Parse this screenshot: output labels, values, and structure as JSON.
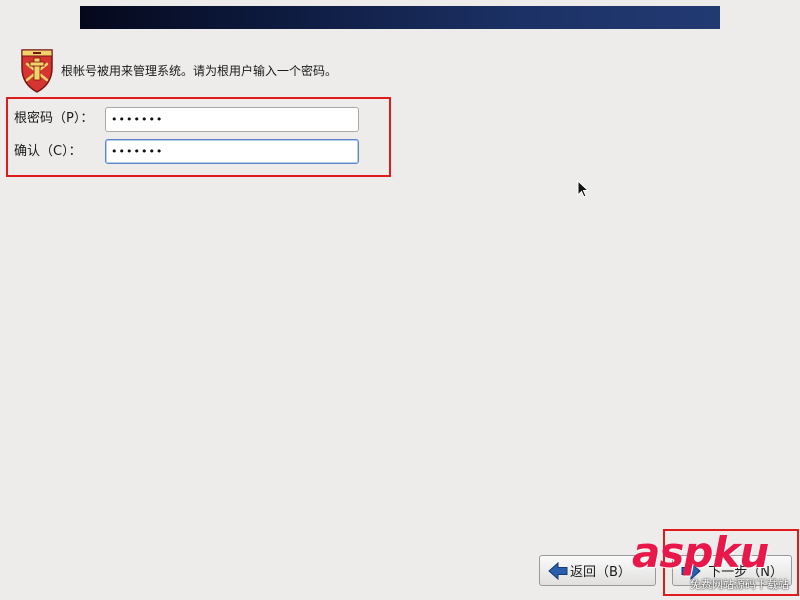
{
  "header": {
    "intro_text": "根帐号被用来管理系统。请为根用户输入一个密码。",
    "icon": "shield-crest-icon"
  },
  "form": {
    "root_password": {
      "label": "根密码（P）：",
      "value": "•••••••"
    },
    "confirm_password": {
      "label": "确认（C）：",
      "value": "•••••••"
    }
  },
  "navigation": {
    "back_label": "返回（B）",
    "back_icon": "arrow-left-icon",
    "next_label": "下一步（N）",
    "next_icon": "arrow-right-icon"
  },
  "watermark": {
    "brand": "aspku",
    "tagline": "免费网站源码下载站"
  },
  "colors": {
    "banner": "#0d1a3e",
    "highlight": "#e01b1b",
    "background": "#edeceb",
    "arrow_blue": "#2a5fb0",
    "watermark": "#e8194a"
  }
}
